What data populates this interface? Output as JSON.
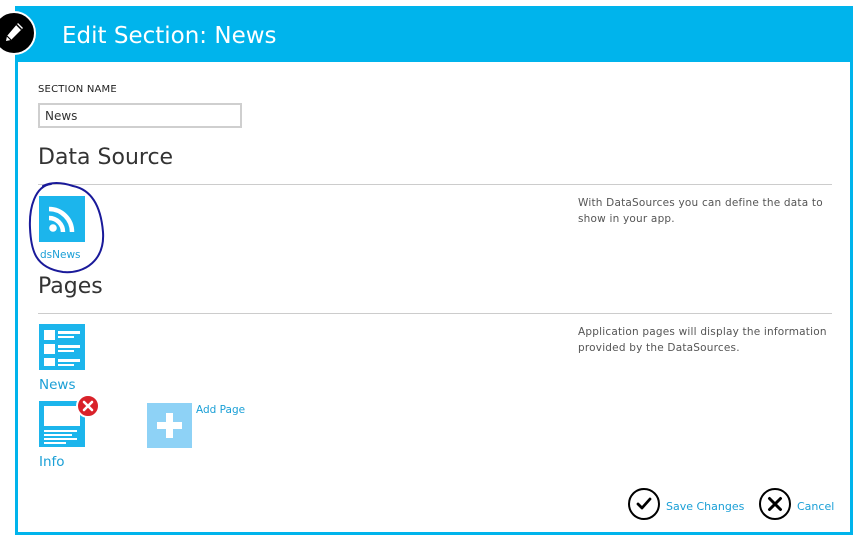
{
  "dialog": {
    "title": "Edit Section: News"
  },
  "icons": {
    "edit": "pencil-icon",
    "datasource": "rss-icon",
    "page_list": "list-page-icon",
    "page_detail": "detail-page-icon",
    "remove": "remove-x-icon",
    "add": "plus-icon",
    "save": "checkmark-icon",
    "cancel": "cancel-x-icon"
  },
  "colors": {
    "accent": "#00b4ec",
    "tile": "#1cb5ec",
    "tile_disabled": "#8ed2f6",
    "link": "#1a9fd6",
    "delete": "#d9222a"
  },
  "section_name": {
    "label": "SECTION NAME",
    "value": "News"
  },
  "datasource": {
    "heading": "Data Source",
    "help": "With DataSources you can define the data to show in your app.",
    "items": [
      {
        "label": "dsNews"
      }
    ]
  },
  "pages": {
    "heading": "Pages",
    "help": "Application pages will display the information provided by the DataSources.",
    "items": [
      {
        "label": "News"
      },
      {
        "label": "Info"
      }
    ],
    "add_label": "Add Page"
  },
  "actions": {
    "save": "Save Changes",
    "cancel": "Cancel"
  }
}
